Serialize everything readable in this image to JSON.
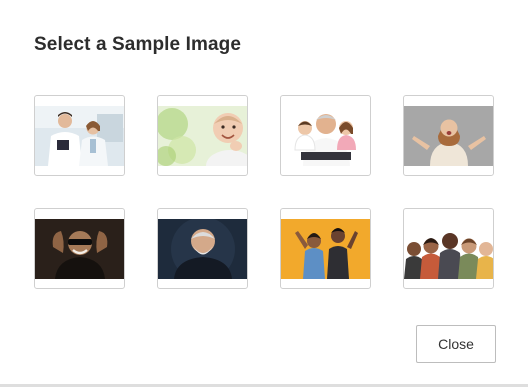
{
  "dialog": {
    "title": "Select a Sample Image",
    "close_label": "Close"
  },
  "images": [
    {
      "subject": "doctor-and-patient"
    },
    {
      "subject": "smiling-baby"
    },
    {
      "subject": "grandfather-with-children"
    },
    {
      "subject": "surprised-woman"
    },
    {
      "subject": "man-with-sunglasses"
    },
    {
      "subject": "elderly-bearded-man"
    },
    {
      "subject": "couple-on-orange"
    },
    {
      "subject": "group-of-friends"
    }
  ]
}
